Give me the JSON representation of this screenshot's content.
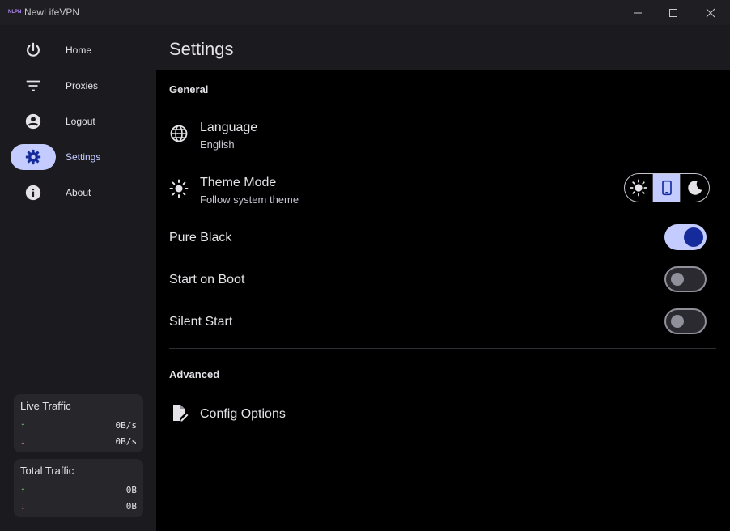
{
  "window": {
    "title": "NewLifeVPN",
    "logo_text": "NLPN"
  },
  "sidebar": {
    "items": [
      {
        "label": "Home",
        "icon": "power-icon"
      },
      {
        "label": "Proxies",
        "icon": "filter-icon"
      },
      {
        "label": "Logout",
        "icon": "account-icon"
      },
      {
        "label": "Settings",
        "icon": "gear-icon",
        "active": true
      },
      {
        "label": "About",
        "icon": "info-icon"
      }
    ],
    "live_traffic": {
      "title": "Live Traffic",
      "up": "0B/s",
      "down": "0B/s"
    },
    "total_traffic": {
      "title": "Total Traffic",
      "up": "0B",
      "down": "0B"
    }
  },
  "main": {
    "title": "Settings",
    "general": {
      "title": "General",
      "language": {
        "title": "Language",
        "value": "English"
      },
      "theme": {
        "title": "Theme Mode",
        "value": "Follow system theme",
        "options": [
          "light",
          "system",
          "dark"
        ],
        "selected": "system"
      },
      "pure_black": {
        "title": "Pure Black",
        "enabled": true
      },
      "start_on_boot": {
        "title": "Start on Boot",
        "enabled": false
      },
      "silent_start": {
        "title": "Silent Start",
        "enabled": false
      }
    },
    "advanced": {
      "title": "Advanced",
      "config_options": {
        "title": "Config Options"
      }
    }
  },
  "colors": {
    "accent": "#c4cbff",
    "accent_dark": "#152b9c",
    "background": "#000000",
    "sidebar": "#1b1b1f"
  }
}
